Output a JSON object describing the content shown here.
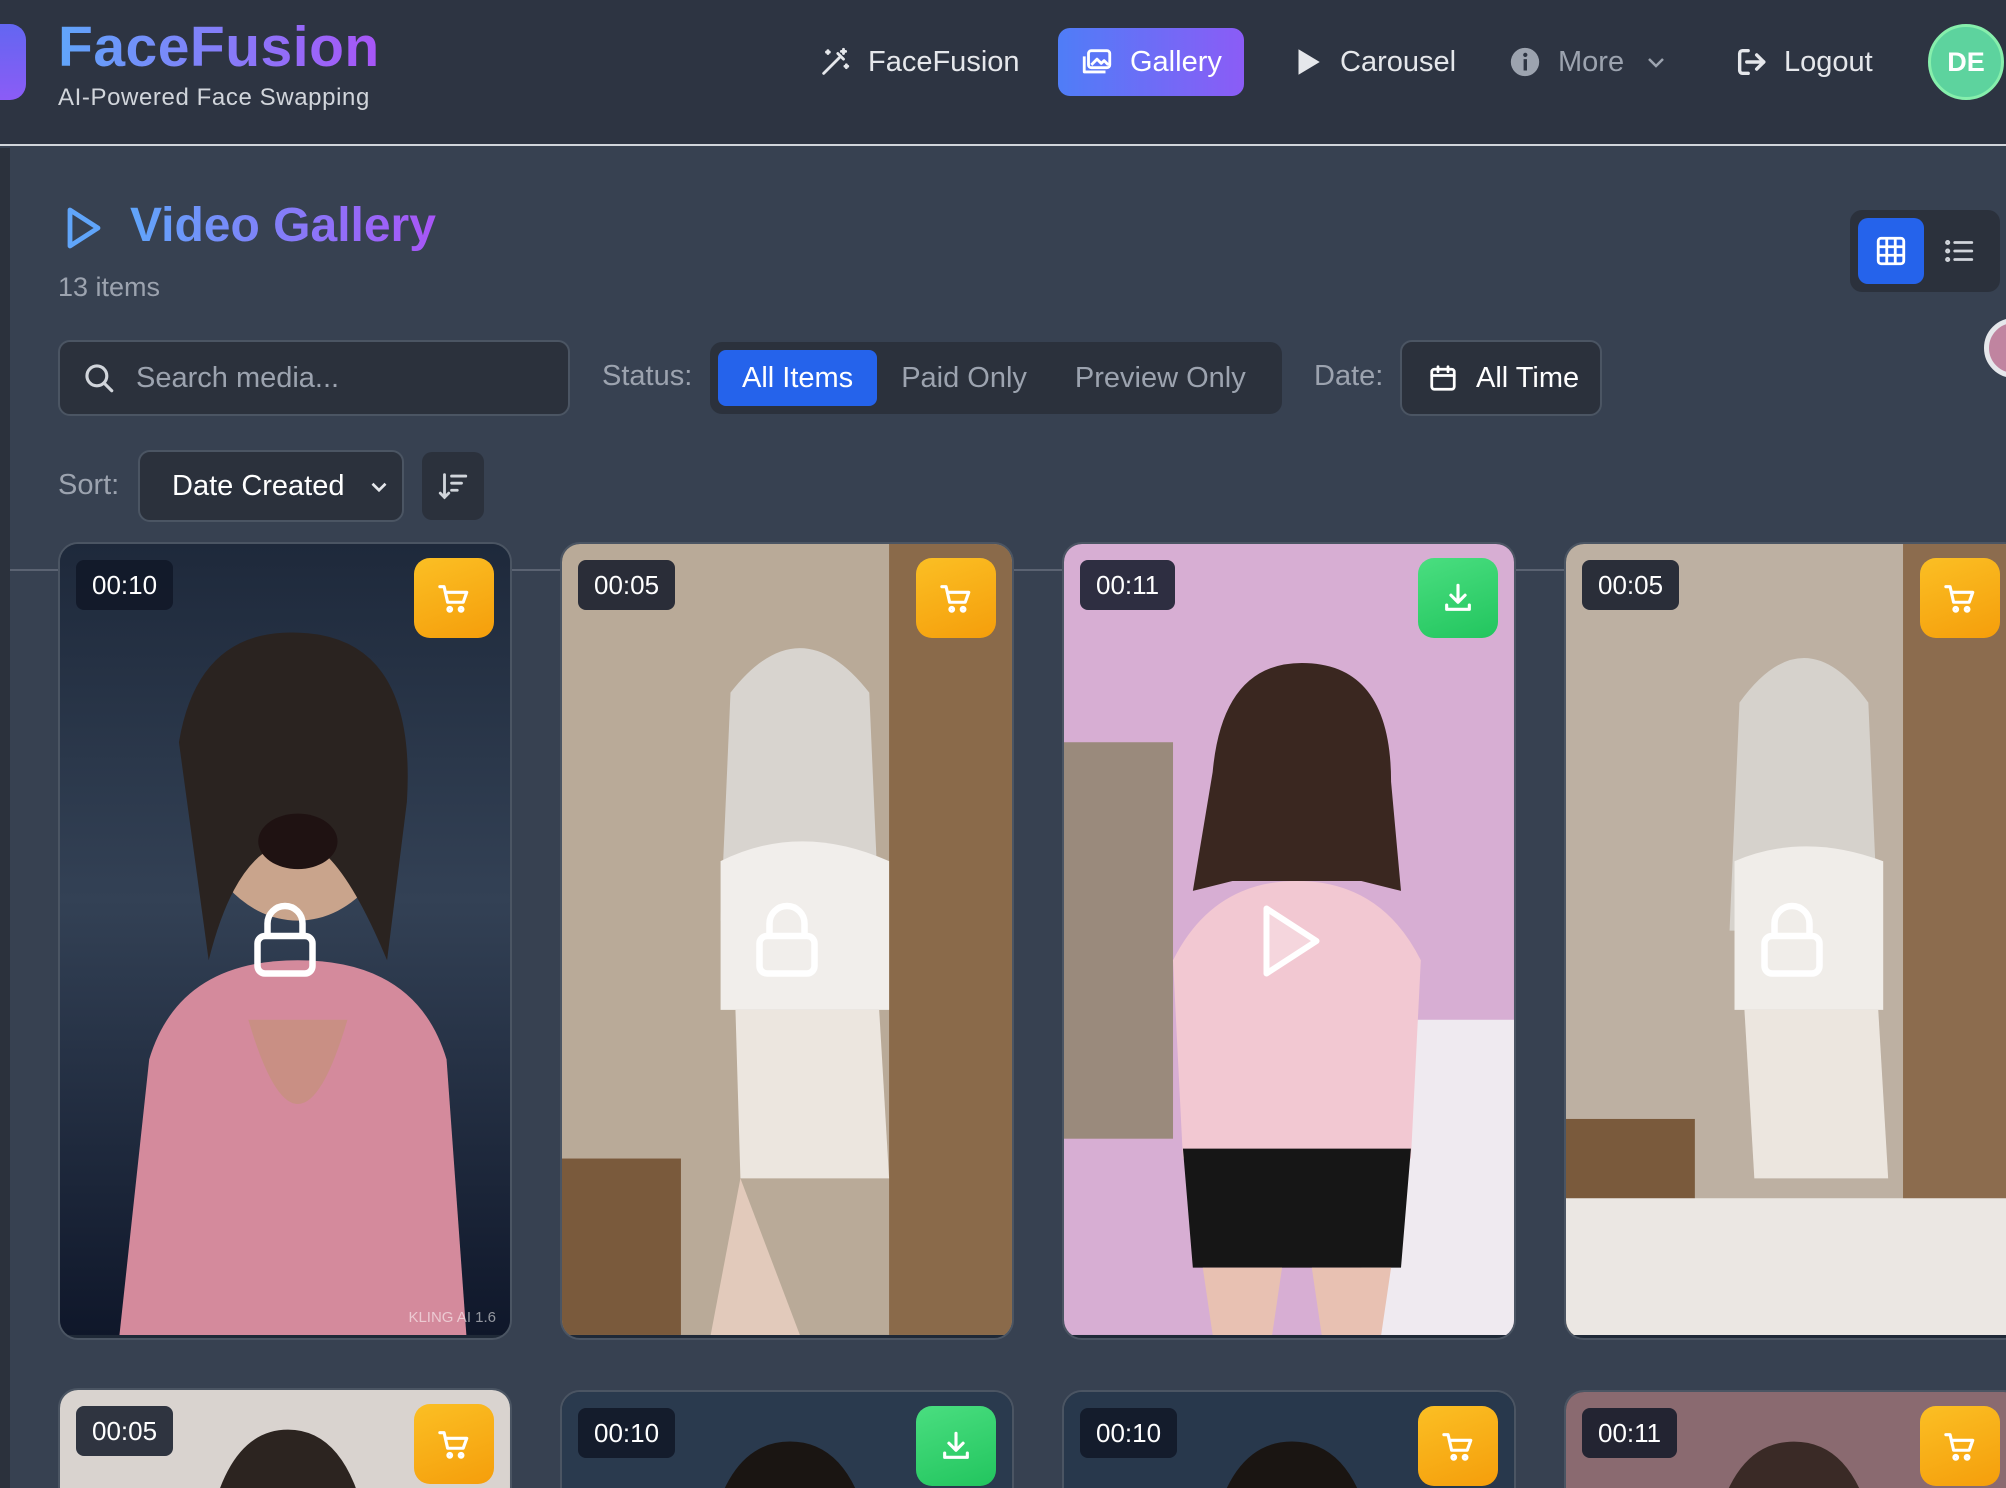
{
  "brand": {
    "title": "FaceFusion",
    "subtitle": "AI-Powered Face Swapping"
  },
  "nav": {
    "items": [
      {
        "label": "FaceFusion",
        "icon": "magic-wand-icon"
      },
      {
        "label": "Gallery",
        "icon": "images-icon",
        "active": true
      },
      {
        "label": "Carousel",
        "icon": "play-icon"
      },
      {
        "label": "More",
        "icon": "info-icon"
      },
      {
        "label": "Logout",
        "icon": "logout-icon"
      }
    ],
    "avatar_initials": "DE"
  },
  "page": {
    "title": "Video Gallery",
    "count": "13 items"
  },
  "filters": {
    "search_placeholder": "Search media...",
    "status_label": "Status:",
    "status_options": [
      "All Items",
      "Paid Only",
      "Preview Only"
    ],
    "status_selected": "All Items",
    "date_label": "Date:",
    "date_value": "All Time",
    "sort_label": "Sort:",
    "sort_value": "Date Created"
  },
  "view": {
    "mode": "grid"
  },
  "colors": {
    "accent": "#2563eb",
    "cart": "#f59e0b",
    "download": "#22c55e",
    "background": "#374151",
    "navbar": "#2d3442"
  },
  "cards": [
    {
      "duration": "00:10",
      "action": "cart",
      "overlay": "lock-icon",
      "watermark": "KLING AI 1.6"
    },
    {
      "duration": "00:05",
      "action": "cart",
      "overlay": "lock-icon",
      "watermark": ""
    },
    {
      "duration": "00:11",
      "action": "download",
      "overlay": "play-icon",
      "watermark": ""
    },
    {
      "duration": "00:05",
      "action": "cart",
      "overlay": "lock-icon",
      "watermark": ""
    },
    {
      "duration": "00:05",
      "action": "cart",
      "overlay": "",
      "watermark": ""
    },
    {
      "duration": "00:10",
      "action": "download",
      "overlay": "",
      "watermark": ""
    },
    {
      "duration": "00:10",
      "action": "cart",
      "overlay": "",
      "watermark": ""
    },
    {
      "duration": "00:11",
      "action": "cart",
      "overlay": "",
      "watermark": ""
    }
  ]
}
